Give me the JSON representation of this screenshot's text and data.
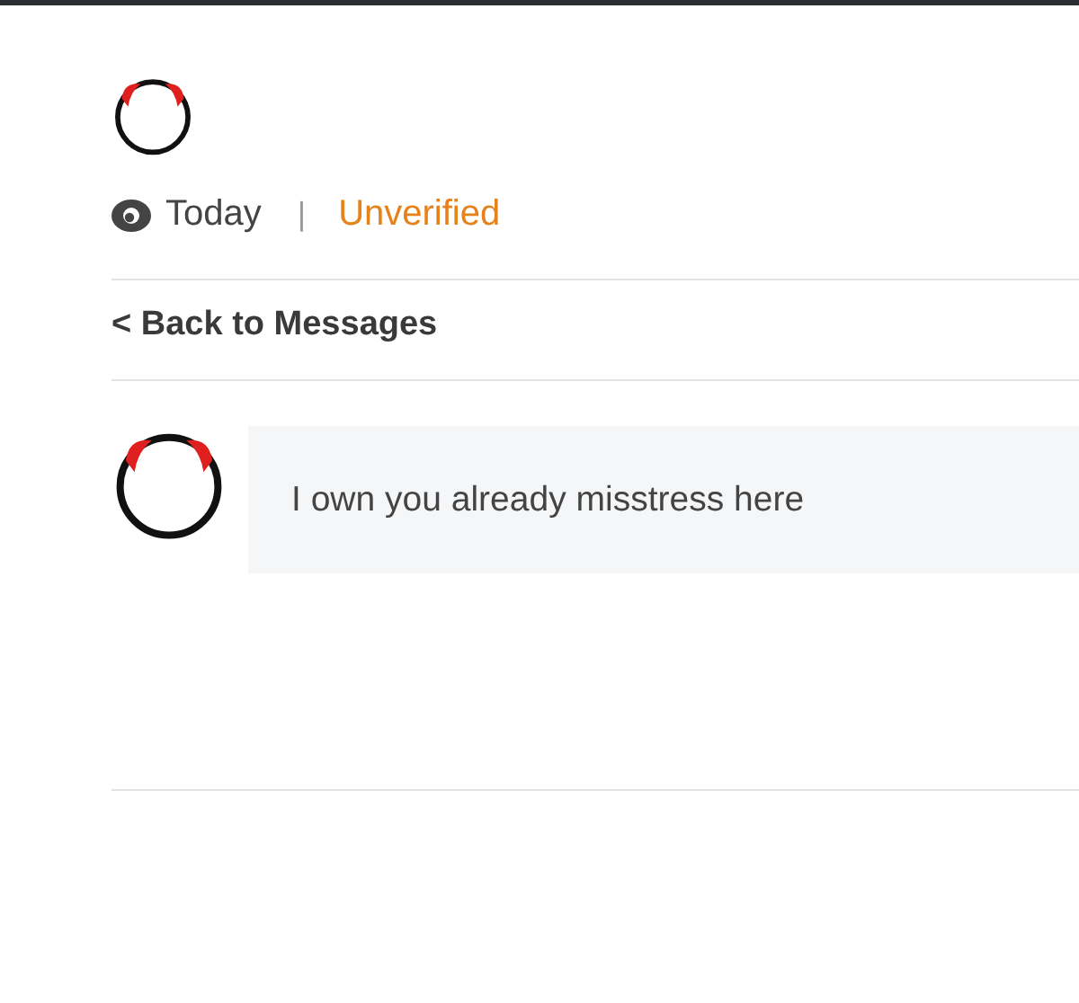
{
  "header": {
    "date": "Today",
    "separator": "|",
    "status": "Unverified"
  },
  "back_link": "< Back to Messages",
  "messages": [
    {
      "text": "I own you already misstress here"
    }
  ]
}
